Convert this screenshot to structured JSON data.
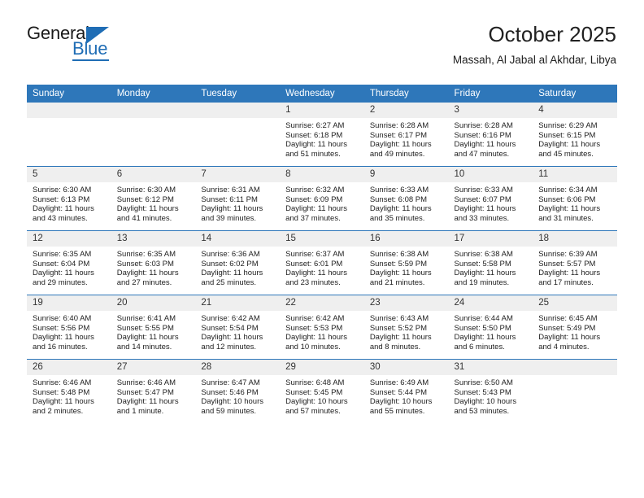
{
  "logo": {
    "top_text": "General",
    "bottom_text": "Blue",
    "accent_color": "#1f6db5",
    "icon": "triangle-flag-icon"
  },
  "header": {
    "month_title": "October 2025",
    "location": "Massah, Al Jabal al Akhdar, Libya"
  },
  "theme": {
    "header_blue": "#2e77ba",
    "daynum_gray": "#efefef"
  },
  "calendar": {
    "weekday_headers": [
      "Sunday",
      "Monday",
      "Tuesday",
      "Wednesday",
      "Thursday",
      "Friday",
      "Saturday"
    ],
    "weeks": [
      [
        {
          "day": "",
          "blank": true,
          "sunrise": "",
          "sunset": "",
          "daylight_1": "",
          "daylight_2": ""
        },
        {
          "day": "",
          "blank": true,
          "sunrise": "",
          "sunset": "",
          "daylight_1": "",
          "daylight_2": ""
        },
        {
          "day": "",
          "blank": true,
          "sunrise": "",
          "sunset": "",
          "daylight_1": "",
          "daylight_2": ""
        },
        {
          "day": "1",
          "sunrise": "Sunrise: 6:27 AM",
          "sunset": "Sunset: 6:18 PM",
          "daylight_1": "Daylight: 11 hours",
          "daylight_2": "and 51 minutes."
        },
        {
          "day": "2",
          "sunrise": "Sunrise: 6:28 AM",
          "sunset": "Sunset: 6:17 PM",
          "daylight_1": "Daylight: 11 hours",
          "daylight_2": "and 49 minutes."
        },
        {
          "day": "3",
          "sunrise": "Sunrise: 6:28 AM",
          "sunset": "Sunset: 6:16 PM",
          "daylight_1": "Daylight: 11 hours",
          "daylight_2": "and 47 minutes."
        },
        {
          "day": "4",
          "sunrise": "Sunrise: 6:29 AM",
          "sunset": "Sunset: 6:15 PM",
          "daylight_1": "Daylight: 11 hours",
          "daylight_2": "and 45 minutes."
        }
      ],
      [
        {
          "day": "5",
          "sunrise": "Sunrise: 6:30 AM",
          "sunset": "Sunset: 6:13 PM",
          "daylight_1": "Daylight: 11 hours",
          "daylight_2": "and 43 minutes."
        },
        {
          "day": "6",
          "sunrise": "Sunrise: 6:30 AM",
          "sunset": "Sunset: 6:12 PM",
          "daylight_1": "Daylight: 11 hours",
          "daylight_2": "and 41 minutes."
        },
        {
          "day": "7",
          "sunrise": "Sunrise: 6:31 AM",
          "sunset": "Sunset: 6:11 PM",
          "daylight_1": "Daylight: 11 hours",
          "daylight_2": "and 39 minutes."
        },
        {
          "day": "8",
          "sunrise": "Sunrise: 6:32 AM",
          "sunset": "Sunset: 6:09 PM",
          "daylight_1": "Daylight: 11 hours",
          "daylight_2": "and 37 minutes."
        },
        {
          "day": "9",
          "sunrise": "Sunrise: 6:33 AM",
          "sunset": "Sunset: 6:08 PM",
          "daylight_1": "Daylight: 11 hours",
          "daylight_2": "and 35 minutes."
        },
        {
          "day": "10",
          "sunrise": "Sunrise: 6:33 AM",
          "sunset": "Sunset: 6:07 PM",
          "daylight_1": "Daylight: 11 hours",
          "daylight_2": "and 33 minutes."
        },
        {
          "day": "11",
          "sunrise": "Sunrise: 6:34 AM",
          "sunset": "Sunset: 6:06 PM",
          "daylight_1": "Daylight: 11 hours",
          "daylight_2": "and 31 minutes."
        }
      ],
      [
        {
          "day": "12",
          "sunrise": "Sunrise: 6:35 AM",
          "sunset": "Sunset: 6:04 PM",
          "daylight_1": "Daylight: 11 hours",
          "daylight_2": "and 29 minutes."
        },
        {
          "day": "13",
          "sunrise": "Sunrise: 6:35 AM",
          "sunset": "Sunset: 6:03 PM",
          "daylight_1": "Daylight: 11 hours",
          "daylight_2": "and 27 minutes."
        },
        {
          "day": "14",
          "sunrise": "Sunrise: 6:36 AM",
          "sunset": "Sunset: 6:02 PM",
          "daylight_1": "Daylight: 11 hours",
          "daylight_2": "and 25 minutes."
        },
        {
          "day": "15",
          "sunrise": "Sunrise: 6:37 AM",
          "sunset": "Sunset: 6:01 PM",
          "daylight_1": "Daylight: 11 hours",
          "daylight_2": "and 23 minutes."
        },
        {
          "day": "16",
          "sunrise": "Sunrise: 6:38 AM",
          "sunset": "Sunset: 5:59 PM",
          "daylight_1": "Daylight: 11 hours",
          "daylight_2": "and 21 minutes."
        },
        {
          "day": "17",
          "sunrise": "Sunrise: 6:38 AM",
          "sunset": "Sunset: 5:58 PM",
          "daylight_1": "Daylight: 11 hours",
          "daylight_2": "and 19 minutes."
        },
        {
          "day": "18",
          "sunrise": "Sunrise: 6:39 AM",
          "sunset": "Sunset: 5:57 PM",
          "daylight_1": "Daylight: 11 hours",
          "daylight_2": "and 17 minutes."
        }
      ],
      [
        {
          "day": "19",
          "sunrise": "Sunrise: 6:40 AM",
          "sunset": "Sunset: 5:56 PM",
          "daylight_1": "Daylight: 11 hours",
          "daylight_2": "and 16 minutes."
        },
        {
          "day": "20",
          "sunrise": "Sunrise: 6:41 AM",
          "sunset": "Sunset: 5:55 PM",
          "daylight_1": "Daylight: 11 hours",
          "daylight_2": "and 14 minutes."
        },
        {
          "day": "21",
          "sunrise": "Sunrise: 6:42 AM",
          "sunset": "Sunset: 5:54 PM",
          "daylight_1": "Daylight: 11 hours",
          "daylight_2": "and 12 minutes."
        },
        {
          "day": "22",
          "sunrise": "Sunrise: 6:42 AM",
          "sunset": "Sunset: 5:53 PM",
          "daylight_1": "Daylight: 11 hours",
          "daylight_2": "and 10 minutes."
        },
        {
          "day": "23",
          "sunrise": "Sunrise: 6:43 AM",
          "sunset": "Sunset: 5:52 PM",
          "daylight_1": "Daylight: 11 hours",
          "daylight_2": "and 8 minutes."
        },
        {
          "day": "24",
          "sunrise": "Sunrise: 6:44 AM",
          "sunset": "Sunset: 5:50 PM",
          "daylight_1": "Daylight: 11 hours",
          "daylight_2": "and 6 minutes."
        },
        {
          "day": "25",
          "sunrise": "Sunrise: 6:45 AM",
          "sunset": "Sunset: 5:49 PM",
          "daylight_1": "Daylight: 11 hours",
          "daylight_2": "and 4 minutes."
        }
      ],
      [
        {
          "day": "26",
          "sunrise": "Sunrise: 6:46 AM",
          "sunset": "Sunset: 5:48 PM",
          "daylight_1": "Daylight: 11 hours",
          "daylight_2": "and 2 minutes."
        },
        {
          "day": "27",
          "sunrise": "Sunrise: 6:46 AM",
          "sunset": "Sunset: 5:47 PM",
          "daylight_1": "Daylight: 11 hours",
          "daylight_2": "and 1 minute."
        },
        {
          "day": "28",
          "sunrise": "Sunrise: 6:47 AM",
          "sunset": "Sunset: 5:46 PM",
          "daylight_1": "Daylight: 10 hours",
          "daylight_2": "and 59 minutes."
        },
        {
          "day": "29",
          "sunrise": "Sunrise: 6:48 AM",
          "sunset": "Sunset: 5:45 PM",
          "daylight_1": "Daylight: 10 hours",
          "daylight_2": "and 57 minutes."
        },
        {
          "day": "30",
          "sunrise": "Sunrise: 6:49 AM",
          "sunset": "Sunset: 5:44 PM",
          "daylight_1": "Daylight: 10 hours",
          "daylight_2": "and 55 minutes."
        },
        {
          "day": "31",
          "sunrise": "Sunrise: 6:50 AM",
          "sunset": "Sunset: 5:43 PM",
          "daylight_1": "Daylight: 10 hours",
          "daylight_2": "and 53 minutes."
        },
        {
          "day": "",
          "blank": true,
          "sunrise": "",
          "sunset": "",
          "daylight_1": "",
          "daylight_2": ""
        }
      ]
    ]
  }
}
